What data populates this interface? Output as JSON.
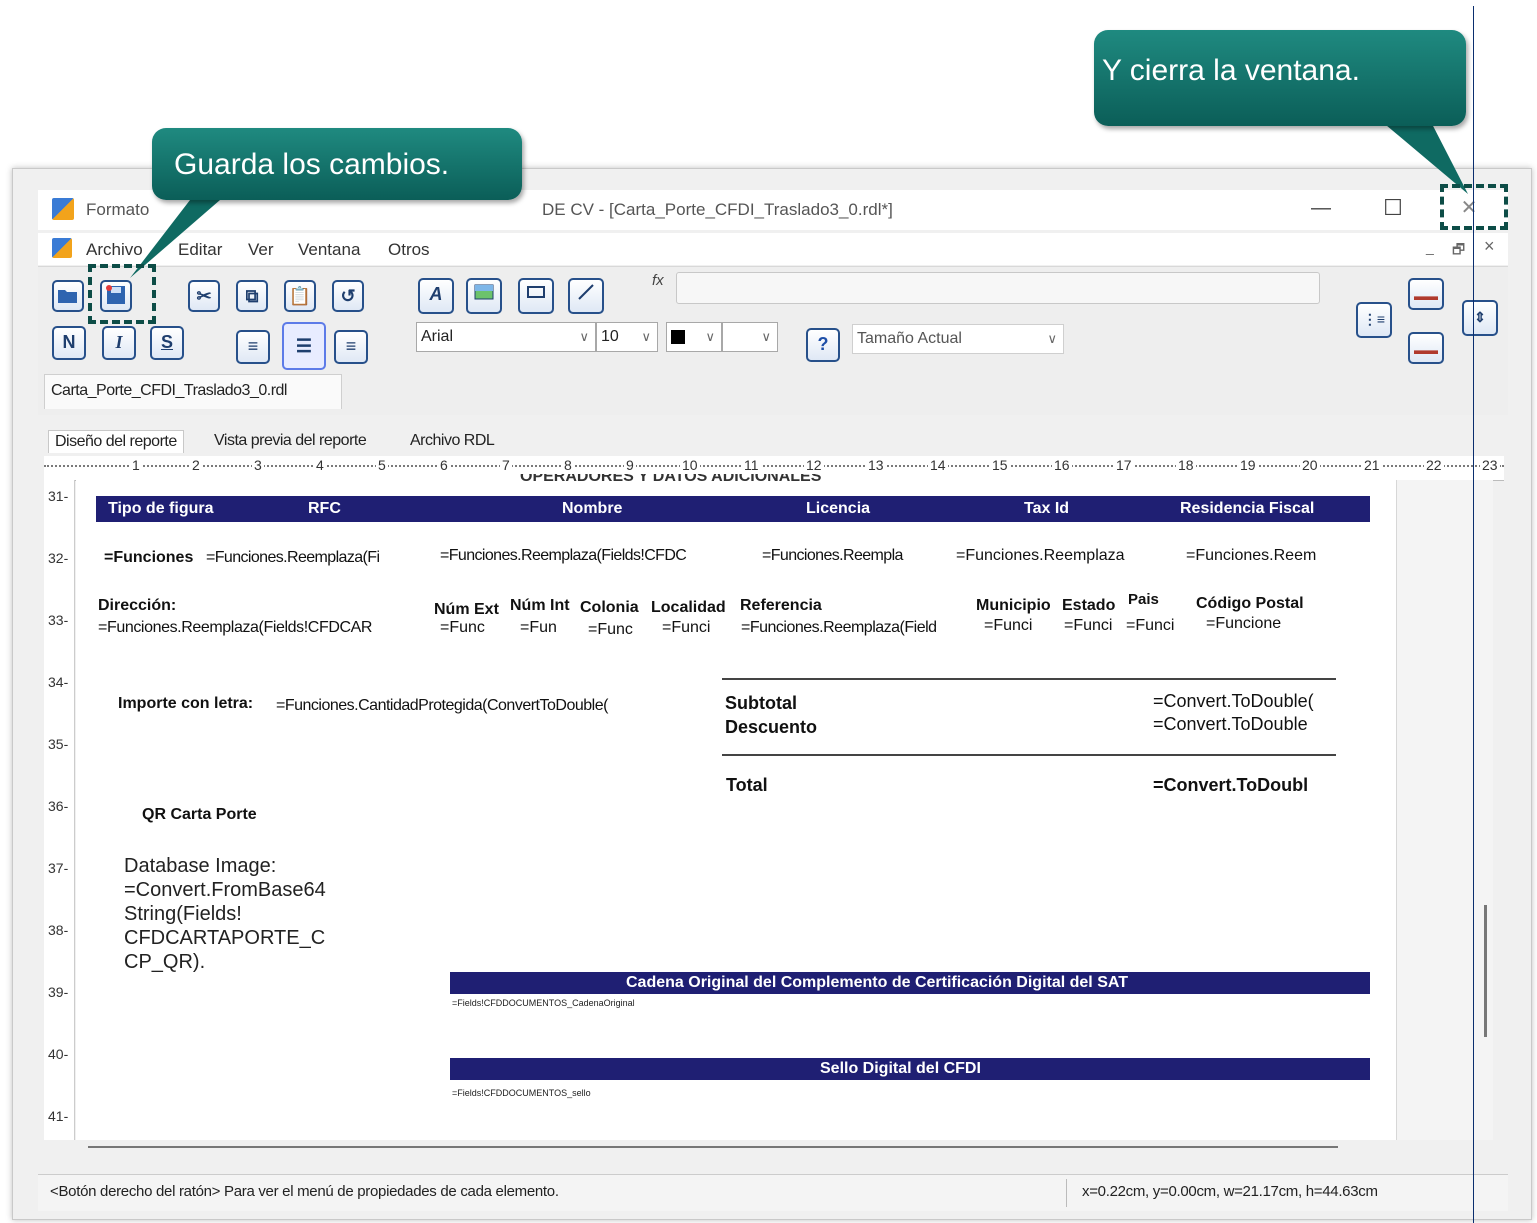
{
  "window": {
    "title": "Formato... - Carta_Porte_CFDI_Traslado3_0.rdl*]",
    "title_visible_left": "Formato",
    "title_visible_right": "DE CV - [Carta_Porte_CFDI_Traslado3_0.rdl*]",
    "minimize": "—",
    "maximize": "☐",
    "close": "✕"
  },
  "menu": {
    "items": [
      "Archivo",
      "Editar",
      "Ver",
      "Ventana",
      "Otros"
    ],
    "mdi_min": "_",
    "mdi_restore": "🗗",
    "mdi_close": "×"
  },
  "toolbar": {
    "formula_label": "fx",
    "formula_value": "",
    "font_name": "Arial",
    "font_size": "10",
    "zoom": "Tamaño Actual",
    "help": "?",
    "bold": "N",
    "italic": "I",
    "strike": "S",
    "icons": [
      "open-folder-icon",
      "save-icon",
      "cut-icon",
      "copy-icon",
      "paste-icon",
      "undo-icon",
      "text-box-icon",
      "image-icon",
      "rectangle-icon",
      "line-icon",
      "align-left-icon",
      "align-center-icon",
      "align-right-icon"
    ]
  },
  "doc_tab": "Carta_Porte_CFDI_Traslado3_0.rdl",
  "report_tabs": [
    "Diseño del reporte",
    "Vista previa del reporte",
    "Archivo RDL"
  ],
  "ruler": {
    "h": [
      "1",
      "2",
      "3",
      "4",
      "5",
      "6",
      "7",
      "8",
      "9",
      "10",
      "11",
      "12",
      "13",
      "14",
      "15",
      "16",
      "17",
      "18",
      "19",
      "20",
      "21",
      "22",
      "23"
    ],
    "v": [
      "31-",
      "32-",
      "33-",
      "34-",
      "35-",
      "36-",
      "37-",
      "38-",
      "39-",
      "40-",
      "41-"
    ]
  },
  "report": {
    "cut_title": "OPERADORES Y DATOS ADICIONALES",
    "header_cols": [
      "Tipo de figura",
      "RFC",
      "Nombre",
      "Licencia",
      "Tax Id",
      "Residencia Fiscal"
    ],
    "row_fields": [
      "=Funciones",
      "=Funciones.Reemplaza(Fi",
      "=Funciones.Reemplaza(Fields!CFDC",
      "=Funciones.Reempla",
      "=Funciones.Reemplaza",
      "=Funciones.Reem"
    ],
    "addr_labels": [
      "Dirección:",
      "Núm Ext",
      "Núm  Int",
      "Colonia",
      "Localidad",
      "Referencia",
      "Municipio",
      "Estado",
      "Pais",
      "Código Postal"
    ],
    "addr_fields": [
      "=Funciones.Reemplaza(Fields!CFDCAR",
      "=Func",
      "=Fun",
      "=Func",
      "=Funci",
      "=Funciones.Reemplaza(Field",
      "=Funci",
      "=Funci",
      "=Funci",
      "=Funcione"
    ],
    "importe_label": "Importe con letra:",
    "importe_value": "=Funciones.CantidadProtegida(ConvertToDouble(",
    "subtotal_label": "Subtotal",
    "subtotal_value": "=Convert.ToDouble(",
    "descuento_label": "Descuento",
    "descuento_value": "=Convert.ToDouble",
    "total_label": "Total",
    "total_value": "=Convert.ToDoubl",
    "qr_label": "QR Carta Porte",
    "qr_lines": [
      "Database Image:",
      "=Convert.FromBase64",
      "String(Fields!",
      "CFDCARTAPORTE_C",
      "CP_QR)."
    ],
    "cadena_header": "Cadena Original del Complemento de Certificación Digital del SAT",
    "cadena_field": "=Fields!CFDDOCUMENTOS_CadenaOriginal",
    "sello_header": "Sello Digital del CFDI",
    "sello_field": "=Fields!CFDDOCUMENTOS_sello"
  },
  "status": {
    "left": "<Botón derecho del ratón> Para ver el menú de propiedades de cada elemento.",
    "right": "x=0.22cm, y=0.00cm, w=21.17cm, h=44.63cm"
  },
  "callouts": {
    "save": "Guarda los cambios.",
    "close": "Y cierra la ventana."
  },
  "colors": {
    "callout": "#147368",
    "header_bar": "#1f1f73",
    "button_border": "#27508a"
  }
}
